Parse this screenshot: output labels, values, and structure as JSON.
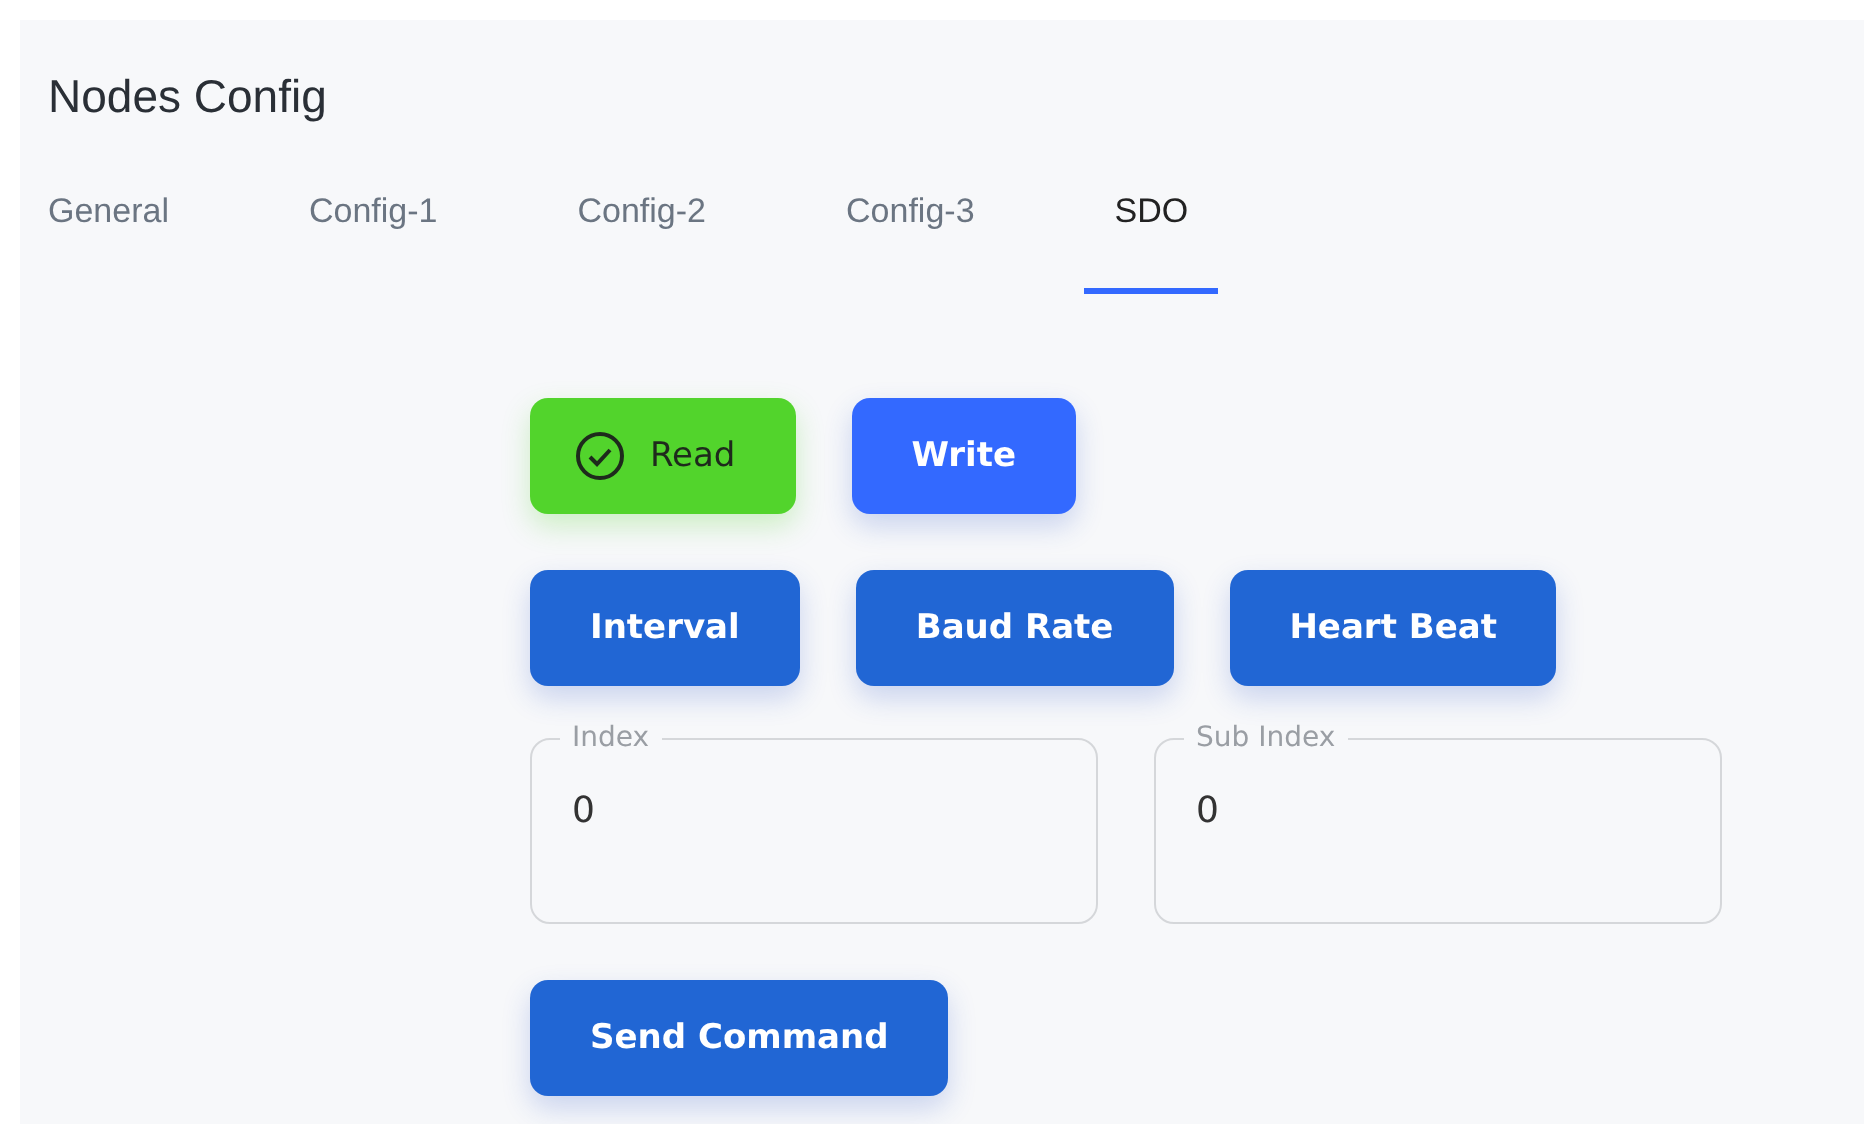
{
  "title": "Nodes Config",
  "tabs": [
    {
      "label": "General",
      "selected": false
    },
    {
      "label": "Config-1",
      "selected": false
    },
    {
      "label": "Config-2",
      "selected": false
    },
    {
      "label": "Config-3",
      "selected": false
    },
    {
      "label": "SDO",
      "selected": true
    }
  ],
  "mode": [
    {
      "label": "Read",
      "selected": true
    },
    {
      "label": "Write",
      "selected": false
    }
  ],
  "parameters": [
    "Interval",
    "Baud Rate",
    "Heart Beat"
  ],
  "fields": [
    {
      "label": "Index",
      "value": "0"
    },
    {
      "label": "Sub Index",
      "value": "0"
    }
  ],
  "send_button": "Send Command"
}
